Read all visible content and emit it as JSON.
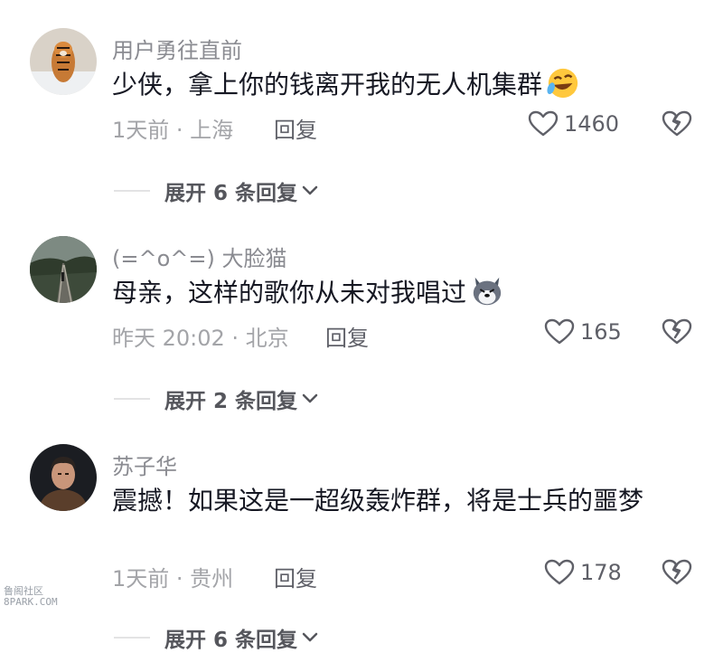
{
  "comments": [
    {
      "username": "用户勇往直前",
      "text": "少侠，拿上你的钱离开我的无人机集群",
      "emoji": "rolling-laughing-emoji",
      "time_location": "1天前 · 上海",
      "reply_label": "回复",
      "likes": "1460",
      "expand_label": "展开 6 条回复"
    },
    {
      "username": "(=^o^=) 大脸猫",
      "text": "母亲，这样的歌你从未对我唱过",
      "emoji": "husky-dog-emoji",
      "time_location": "昨天 20:02 · 北京",
      "reply_label": "回复",
      "likes": "165",
      "expand_label": "展开 2 条回复"
    },
    {
      "username": "苏子华",
      "text": "震撼！如果这是一超级轰炸群，将是士兵的噩梦",
      "emoji": "",
      "time_location": "1天前 · 贵州",
      "reply_label": "回复",
      "likes": "178",
      "expand_label": "展开 6 条回复"
    }
  ],
  "watermark": {
    "line1": "鲁阁社区",
    "line2": "8PARK.COM"
  },
  "colors": {
    "text": "#161823",
    "username": "#8a8b91",
    "meta": "#a3a4a8",
    "icon": "#5f6068"
  }
}
